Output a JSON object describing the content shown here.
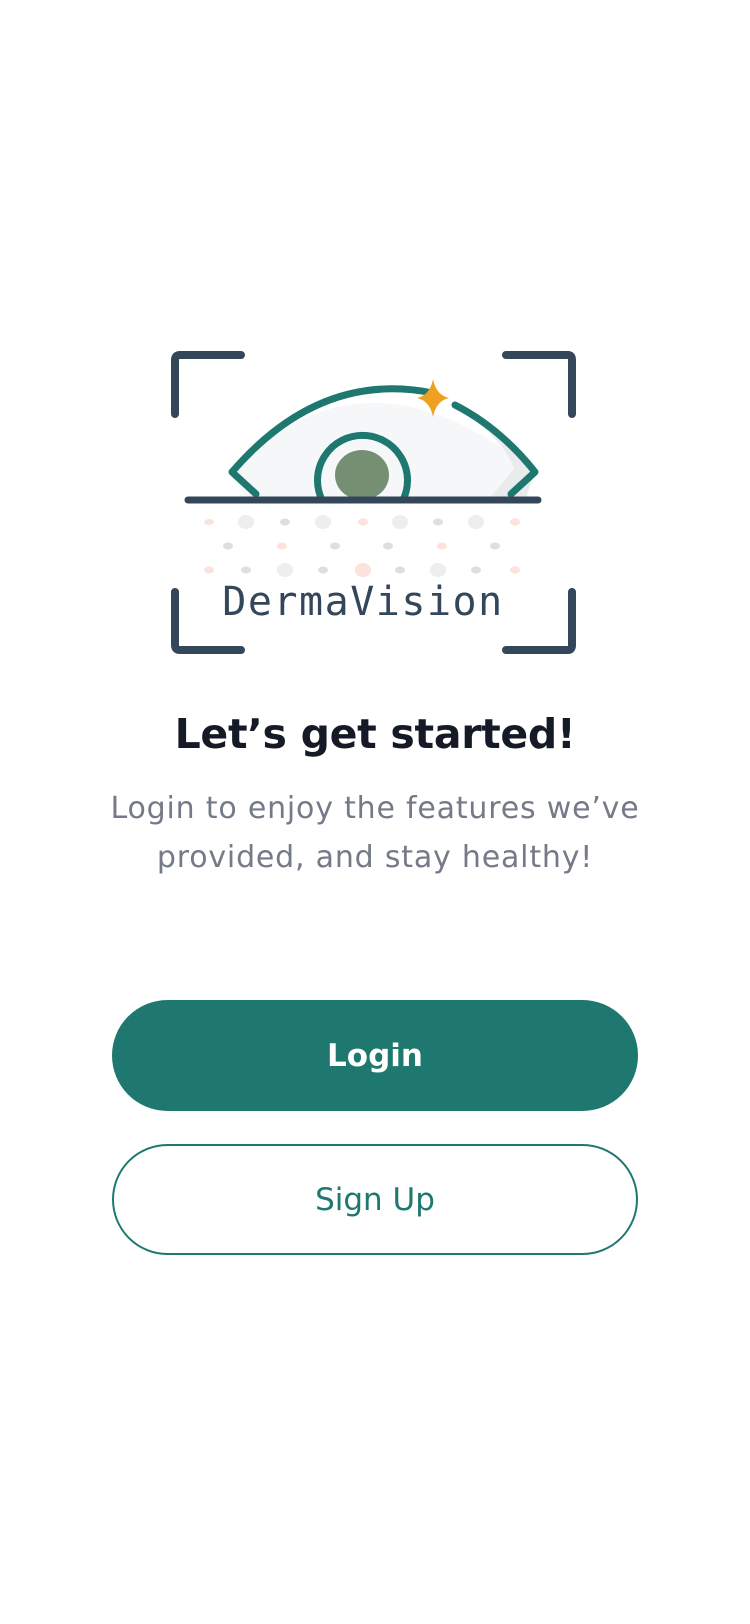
{
  "brand": {
    "name": "DermaVision",
    "colors": {
      "primary": "#1e7870",
      "frame": "#34475a",
      "pupil": "#758f73",
      "sparkle": "#f0a020"
    }
  },
  "welcome": {
    "title": "Let’s get started!",
    "subtitle": "Login to enjoy the features we’ve provided, and stay healthy!"
  },
  "actions": {
    "login_label": "Login",
    "signup_label": "Sign Up"
  },
  "icons": {
    "logo": "eye-scan-logo-icon",
    "sparkle": "sparkle-star-icon"
  }
}
